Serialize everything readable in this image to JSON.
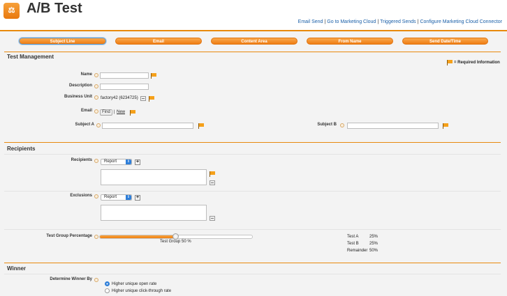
{
  "app": {
    "title": "A/B Test",
    "icon": "scale-icon",
    "accent": "#e8890c"
  },
  "top_links": [
    "Email Send",
    "Go to Marketing Cloud",
    "Triggered Sends",
    "Configure Marketing Cloud Connector"
  ],
  "tabs": [
    "Subject Line",
    "Email",
    "Content Area",
    "From Name",
    "Send Date/Time"
  ],
  "active_tab": "Subject Line",
  "test_management": {
    "title": "Test Management",
    "required_legend": "= Required Information",
    "name_label": "Name",
    "description_label": "Description",
    "business_unit_label": "Business Unit",
    "business_unit_value": "factory42 (6234725)",
    "email_label": "Email",
    "find_button": "Find",
    "new_link": "New",
    "subject_a_label": "Subject A",
    "subject_b_label": "Subject B"
  },
  "recipients": {
    "title": "Recipients",
    "recipients_label": "Recipients",
    "recipients_select": "Report",
    "exclusions_label": "Exclusions",
    "exclusions_select": "Report",
    "test_group_label": "Test Group Percentage",
    "test_group_caption": "Test Group 50 %",
    "test_group_value": 50,
    "summary": [
      {
        "label": "Test A",
        "value": "25%"
      },
      {
        "label": "Test B",
        "value": "25%"
      },
      {
        "label": "Remainder",
        "value": "50%"
      }
    ]
  },
  "winner": {
    "title": "Winner",
    "determine_label": "Determine Winner By",
    "options": [
      "Higher unique open rate",
      "Higher unique click-through rate"
    ],
    "selected": "Higher unique open rate"
  }
}
